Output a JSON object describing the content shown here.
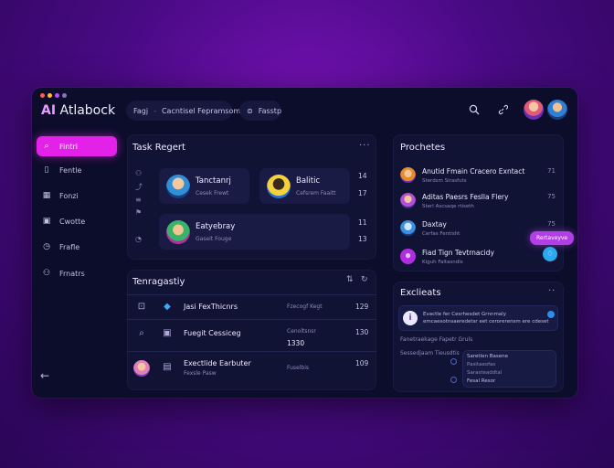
{
  "app": {
    "brand_ai": "AI",
    "brand_name": "Atlabock"
  },
  "colors": {
    "accent": "#e321e8",
    "window_bg": "#0c0d2a",
    "panel_bg": "#111335",
    "badge": "#2aa8f0"
  },
  "topbar": {
    "crumb_1": "Fagj",
    "crumb_sep": "-",
    "crumb_2": "Cacntisel Fepramsom",
    "tab_label": "Fasstp"
  },
  "sidebar": {
    "items": [
      {
        "label": "Fintri",
        "icon": "search-icon"
      },
      {
        "label": "Fentle",
        "icon": "document-icon"
      },
      {
        "label": "Fonzi",
        "icon": "grid-icon"
      },
      {
        "label": "Cwotte",
        "icon": "image-icon"
      },
      {
        "label": "Frafle",
        "icon": "clock-icon"
      },
      {
        "label": "Frnatrs",
        "icon": "people-icon"
      }
    ]
  },
  "task_panel": {
    "title": "Task Regert",
    "cards": [
      {
        "title": "Tanctanrj",
        "subtitle": "Cesek Frewt",
        "num": "14"
      },
      {
        "title": "Balitic",
        "subtitle": "Cefsrem Faaitt",
        "num": "17"
      },
      {
        "title": "Eatyebray",
        "subtitle": "Gaseit Fouge",
        "num": "11"
      }
    ],
    "extra_nums": [
      "13",
      "14"
    ]
  },
  "team_panel": {
    "title": "Tenragastiy",
    "rows": [
      {
        "title": "Jasi FexThicnrs",
        "sub": "Fzecogf Kegt",
        "num": "129"
      },
      {
        "title": "Fuegit Cessiceg",
        "sub": "Cenoltsnsr",
        "sub2": "1330",
        "num": "130"
      },
      {
        "title": "Exectlide Earbuter",
        "sub": "Fuselbis",
        "sub_top": "Fexsle Pasw",
        "num": "109"
      }
    ]
  },
  "products_panel": {
    "title": "Prochetes",
    "items": [
      {
        "title": "Anutid Fmain Cracero Exntact",
        "sub": "Sterdsm Sirasfuts",
        "num": "71"
      },
      {
        "title": "Aditas Paesrs Feslla Flery",
        "sub": "Sterl Ascsaqe rtiseth",
        "num": "75"
      },
      {
        "title": "Daxtay",
        "sub": "Cerfas Fentisht",
        "num": "75"
      },
      {
        "title": "Fiad Tign Tevtrnacidy",
        "sub": "Kiguh Faltasndls",
        "num": ""
      }
    ],
    "chip_label": "Rertaveyve",
    "badge_glyph": "♢"
  },
  "activity_panel": {
    "title": "Exclieats",
    "message": "Evactle fer Cesrhesdet Grnnmaly emcaesotnsaeredetsr eet cerorerensm ere cdeset",
    "lines": [
      "Fanetraekage Fapetr Gruls",
      "Sessedjaam Tieusdtis"
    ],
    "sub_lines": [
      "Saretlen Basene",
      "Pasitaeofas",
      "Sarasteaddtal",
      "Fesal Resor"
    ]
  }
}
